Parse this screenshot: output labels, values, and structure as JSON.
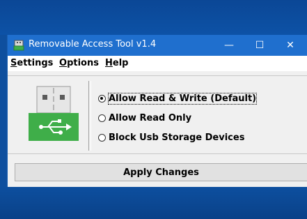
{
  "window": {
    "title": "Removable Access Tool v1.4",
    "minimize_glyph": "—",
    "maximize_glyph": "☐",
    "close_glyph": "✕"
  },
  "menu": {
    "items": [
      {
        "label_ul": "S",
        "label_rest": "ettings"
      },
      {
        "label_ul": "O",
        "label_rest": "ptions"
      },
      {
        "label_ul": "H",
        "label_rest": "elp"
      }
    ]
  },
  "options": [
    {
      "label": "Allow Read & Write (Default)",
      "checked": true
    },
    {
      "label": "Allow Read Only",
      "checked": false
    },
    {
      "label": "Block Usb Storage Devices",
      "checked": false
    }
  ],
  "apply_label": "Apply Changes",
  "colors": {
    "titlebar": "#1f6fce",
    "usb_green": "#3fae49",
    "desktop": "#0e4f9e"
  },
  "icons": {
    "app": "usb-app-icon",
    "device": "usb-drive-icon"
  }
}
